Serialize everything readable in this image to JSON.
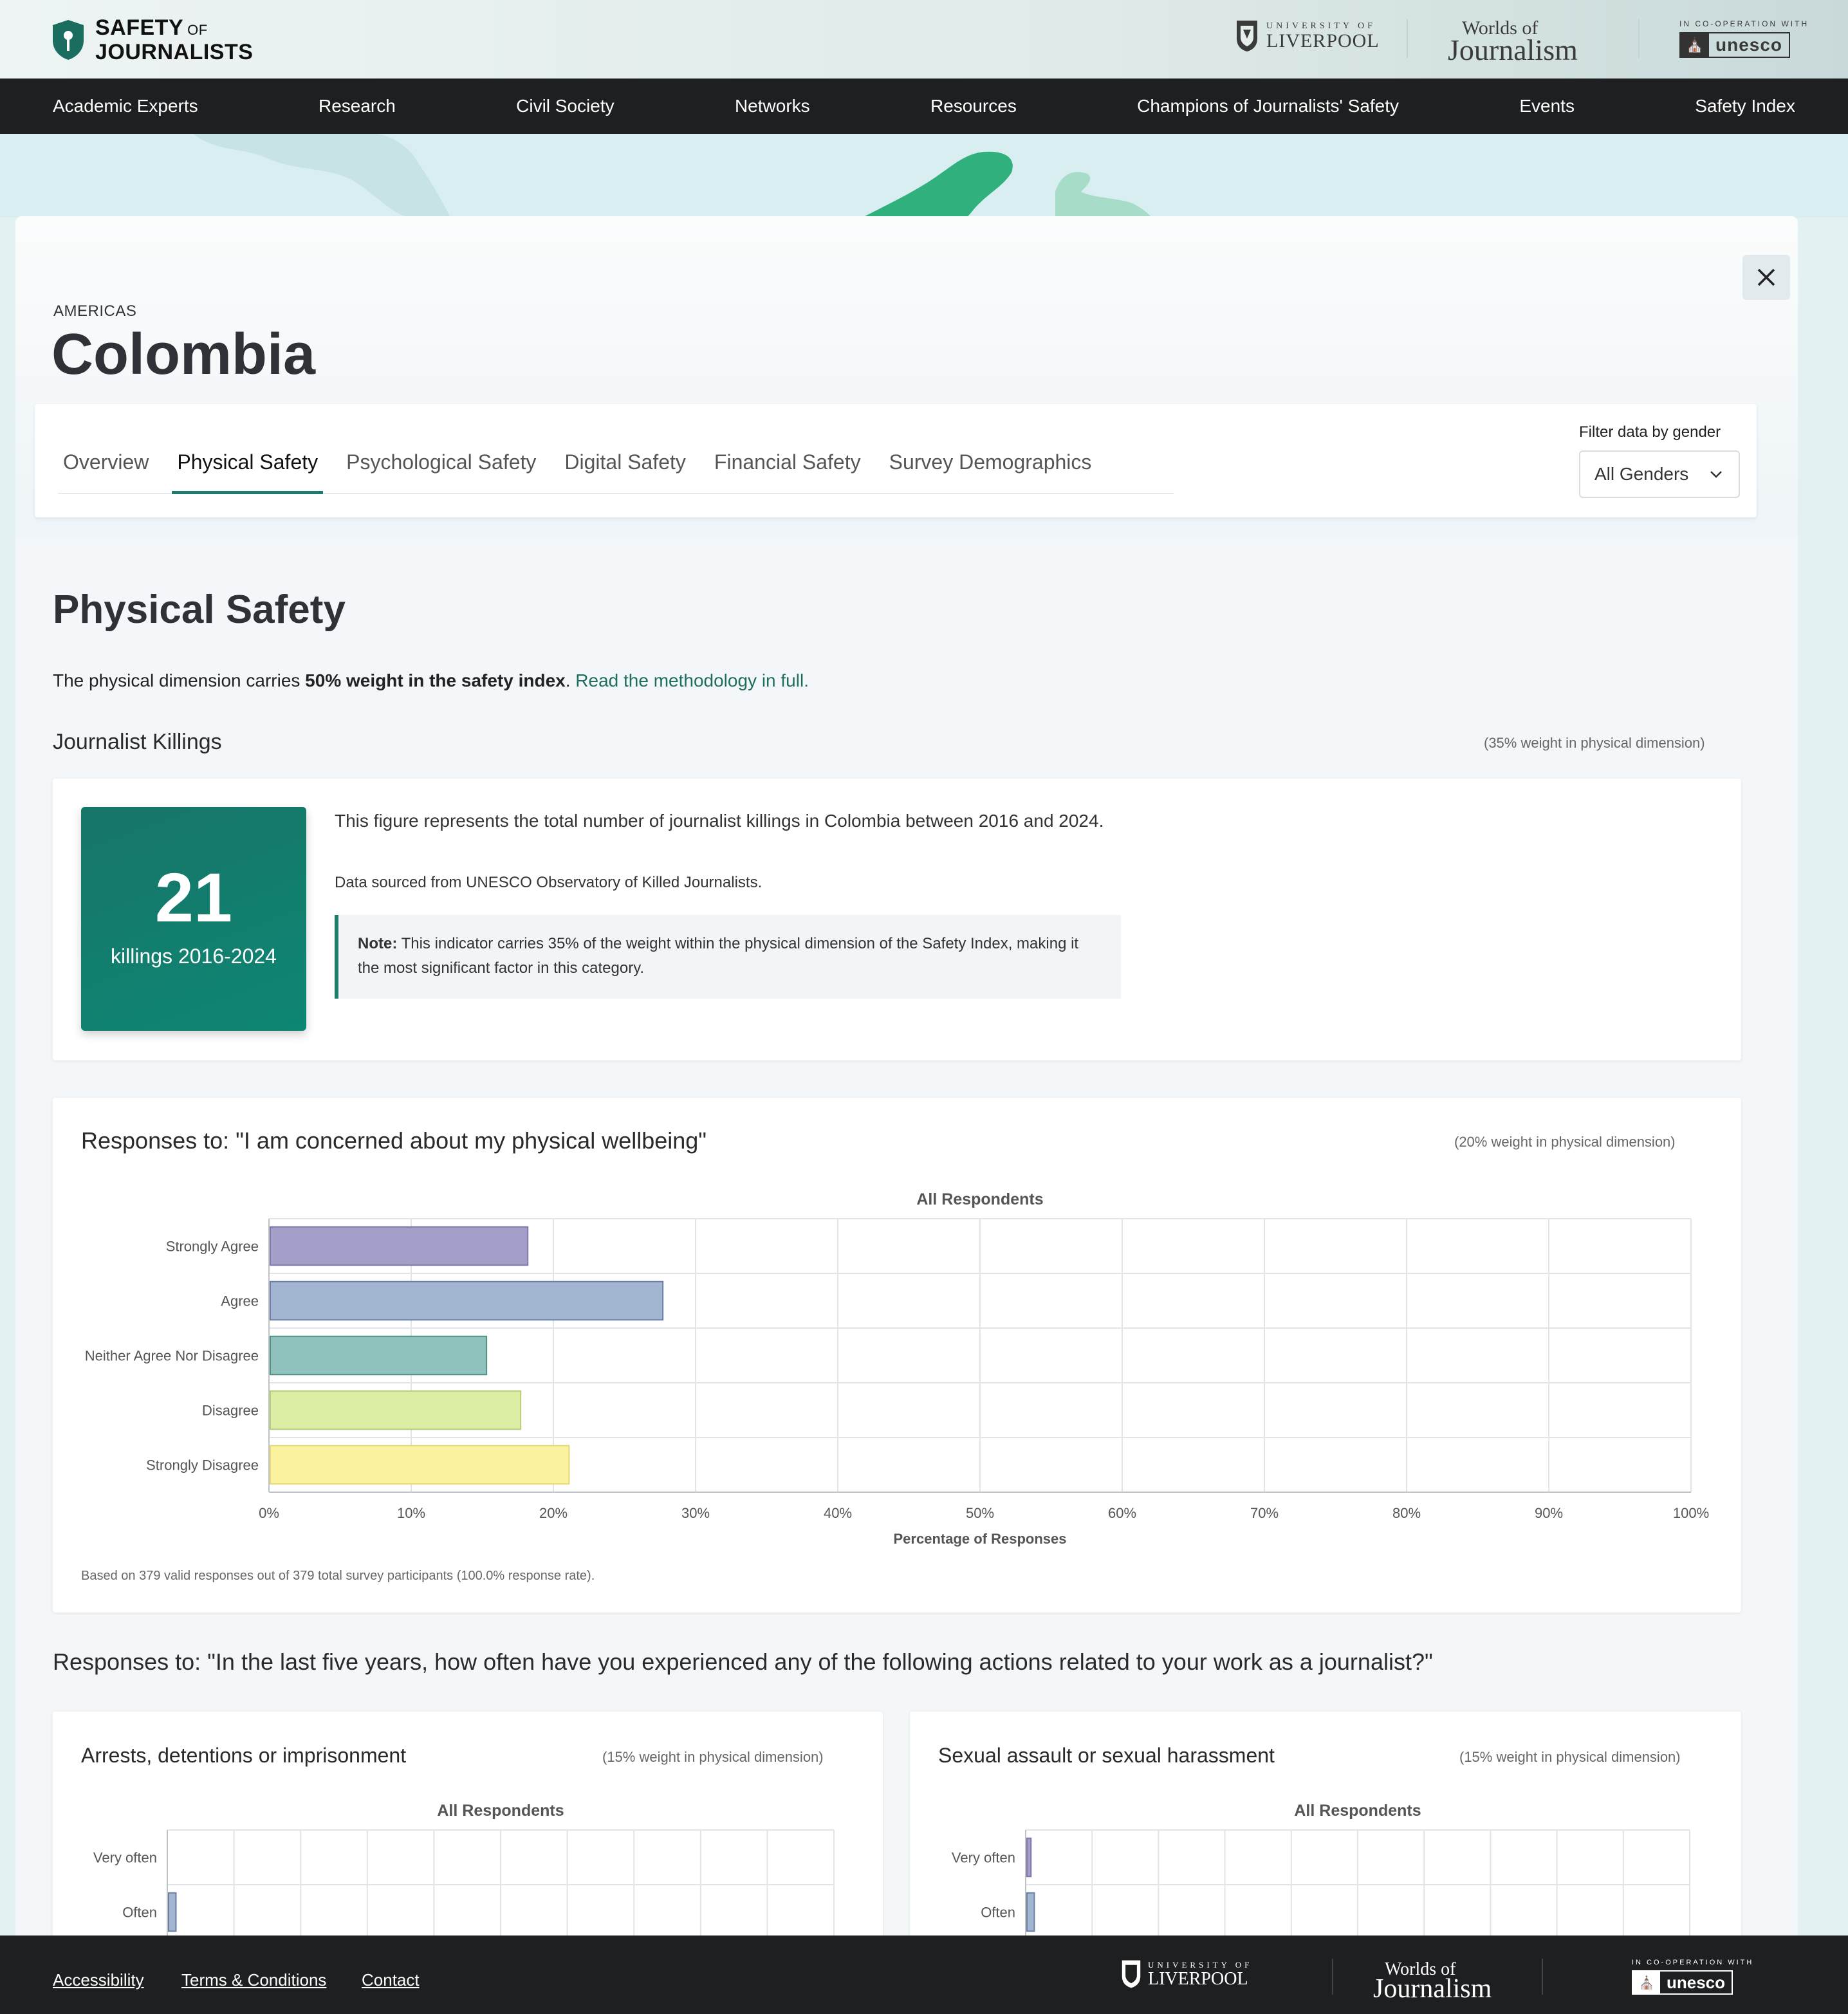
{
  "brand": {
    "line1": "SAFETY",
    "of": "OF",
    "line2": "JOURNALISTS"
  },
  "partners": {
    "liverpool_small": "UNIVERSITY OF",
    "liverpool_big": "LIVERPOOL",
    "woj_top": "Worlds of",
    "woj_big": "Journalism",
    "unesco_small": "IN CO-OPERATION WITH",
    "unesco_word": "unesco"
  },
  "nav": [
    "Academic Experts",
    "Research",
    "Civil Society",
    "Networks",
    "Resources",
    "Champions of Journalists' Safety",
    "Events",
    "Safety Index"
  ],
  "page": {
    "region": "AMERICAS",
    "country": "Colombia"
  },
  "tabs": [
    "Overview",
    "Physical Safety",
    "Psychological Safety",
    "Digital Safety",
    "Financial Safety",
    "Survey Demographics"
  ],
  "active_tab": "Physical Safety",
  "filter": {
    "label": "Filter data by gender",
    "value": "All Genders"
  },
  "section": {
    "title": "Physical Safety",
    "desc_pre": "The physical dimension carries ",
    "desc_bold": "50% weight in the safety index",
    "desc_post": ". ",
    "desc_link": "Read the methodology in full."
  },
  "killings": {
    "title": "Journalist Killings",
    "weight": "(35% weight in physical dimension)",
    "number": "21",
    "label": "killings 2016-2024",
    "desc": "This figure represents the total number of journalist killings in Colombia between 2016 and 2024.",
    "source": "Data sourced from UNESCO Observatory of Killed Journalists.",
    "note_bold": "Note:",
    "note_text": " This indicator carries 35% of the weight within the physical dimension of the Safety Index, making it the most significant factor in this category."
  },
  "wellbeing": {
    "title": "Responses to: \"I am concerned about my physical wellbeing\"",
    "weight": "(20% weight in physical dimension)",
    "footnote": "Based on 379 valid responses out of 379 total survey participants (100.0% response rate)."
  },
  "experiences": {
    "title": "Responses to: \"In the last five years, how often have you experienced any of the following actions related to your work as a journalist?\"",
    "left_title": "Arrests, detentions or imprisonment",
    "left_weight": "(15% weight in physical dimension)",
    "right_title": "Sexual assault or sexual harassment",
    "right_weight": "(15% weight in physical dimension)"
  },
  "footer": {
    "links": [
      "Accessibility",
      "Terms & Conditions",
      "Contact"
    ]
  },
  "colors": {
    "accent": "#1f7c6b",
    "nav_bg": "#1d1f21"
  },
  "chart_data": [
    {
      "type": "bar",
      "orientation": "horizontal",
      "title": "All Respondents",
      "xlabel": "Percentage of Responses",
      "categories": [
        "Strongly Agree",
        "Agree",
        "Neither Agree Nor Disagree",
        "Disagree",
        "Strongly Disagree"
      ],
      "values": [
        18.2,
        27.7,
        15.3,
        17.7,
        21.1
      ],
      "colors": [
        "#a49fc9",
        "#a2b6d2",
        "#8fc2bc",
        "#dbeea4",
        "#fbf39f"
      ],
      "borders": [
        "#7f79a9",
        "#6b7fa3",
        "#4f8f86",
        "#b9cc7a",
        "#e7d97a"
      ],
      "xlim": [
        0,
        100
      ],
      "xticks": [
        "0%",
        "10%",
        "20%",
        "30%",
        "40%",
        "50%",
        "60%",
        "70%",
        "80%",
        "90%",
        "100%"
      ],
      "grid": true
    },
    {
      "type": "bar",
      "orientation": "horizontal",
      "title": "All Respondents",
      "categories": [
        "Very often",
        "Often"
      ],
      "values": [
        0,
        1.3
      ],
      "colors": [
        "#a49fc9",
        "#a2b6d2"
      ],
      "borders": [
        "#7f79a9",
        "#6b7fa3"
      ],
      "xlim": [
        0,
        100
      ],
      "grid": true
    },
    {
      "type": "bar",
      "orientation": "horizontal",
      "title": "All Respondents",
      "categories": [
        "Very often",
        "Often"
      ],
      "values": [
        0.8,
        1.3
      ],
      "colors": [
        "#a49fc9",
        "#a2b6d2"
      ],
      "borders": [
        "#7f79a9",
        "#6b7fa3"
      ],
      "xlim": [
        0,
        100
      ],
      "grid": true
    }
  ]
}
